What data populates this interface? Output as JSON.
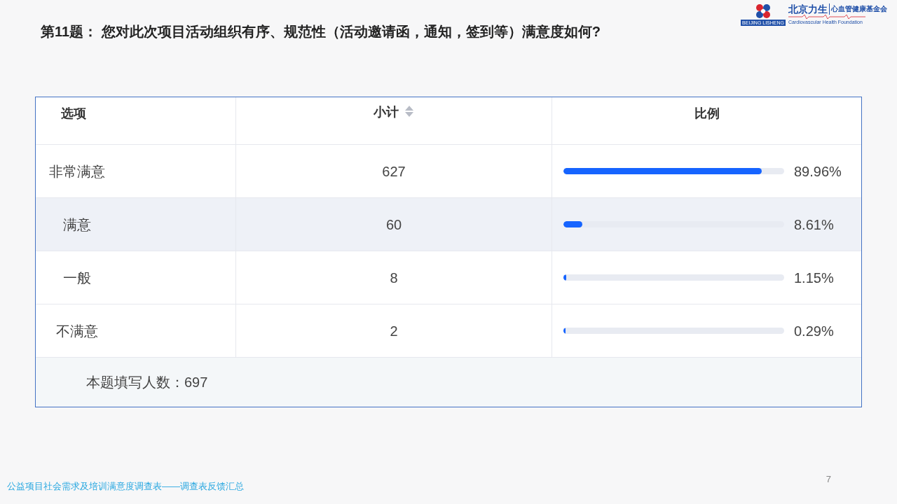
{
  "title": "第11题： 您对此次项目活动组织有序、规范性（活动邀请函，通知，签到等）满意度如何?",
  "logo": {
    "name_cn": "北京力生",
    "name_cn_2": "心血管健康基金会",
    "badge": "BEIJING LISHENG",
    "name_en": "Cardiovascular Health Foundation"
  },
  "table": {
    "columns": [
      "选项",
      "小计",
      "比例"
    ],
    "rows": [
      {
        "option": "非常满意",
        "count": "627",
        "level": 0.8996,
        "percent": "89.96%",
        "highlighted": false
      },
      {
        "option": "满意",
        "count": "60",
        "level": 0.0861,
        "percent": "8.61%",
        "highlighted": true
      },
      {
        "option": "一般",
        "count": "8",
        "level": 0.0115,
        "percent": "1.15%",
        "highlighted": false
      },
      {
        "option": "不满意",
        "count": "2",
        "level": 0.0029,
        "percent": "0.29%",
        "highlighted": false
      }
    ],
    "footer": "本题填写人数：697"
  },
  "footer_caption": "公益项目社会需求及培训满意度调查表——调查表反馈汇总",
  "page_number": "7"
}
